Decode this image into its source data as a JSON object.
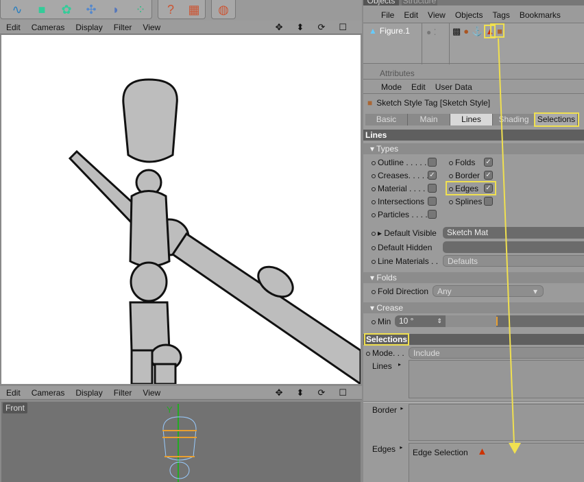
{
  "toolbar": {
    "icons": [
      "spline-pen-icon",
      "cube-icon",
      "array-icon",
      "deformer-icon",
      "bend-icon",
      "particles-icon",
      "help-cursor-icon",
      "help-table-icon",
      "render-globe-icon"
    ]
  },
  "viewport_top": {
    "menu": [
      "Edit",
      "Cameras",
      "Display",
      "Filter",
      "View"
    ],
    "nav_icons": [
      "move-icon",
      "zoom-icon",
      "rotate-icon",
      "maximize-icon"
    ]
  },
  "viewport_bottom": {
    "menu": [
      "Edit",
      "Cameras",
      "Display",
      "Filter",
      "View"
    ],
    "view_label": "Front",
    "axis_label": "Y"
  },
  "objects_panel": {
    "tabs": [
      "Objects",
      "Structure"
    ],
    "menu": [
      "File",
      "Edit",
      "View",
      "Objects",
      "Tags",
      "Bookmarks"
    ],
    "object_name": "Figure.1",
    "tags": [
      "checker-tag-icon",
      "spheres-tag-icon",
      "anchor-tag-icon",
      "edge-selection-tag-icon",
      "sketch-style-tag-icon"
    ]
  },
  "attributes": {
    "title": "Attributes",
    "menu": [
      "Mode",
      "Edit",
      "User Data"
    ],
    "tag_title": "Sketch Style Tag [Sketch Style]",
    "tabs": [
      "Basic",
      "Main",
      "Lines",
      "Shading",
      "Selections"
    ],
    "active_tab": "Lines"
  },
  "lines": {
    "header": "Lines",
    "types_header": "Types",
    "types_left": [
      {
        "label": "Outline . . . . .",
        "checked": false
      },
      {
        "label": "Creases. . . . .",
        "checked": true
      },
      {
        "label": "Material . . . .",
        "checked": false
      },
      {
        "label": "Intersections",
        "checked": false
      },
      {
        "label": "Particles . . . .",
        "checked": false
      }
    ],
    "types_right": [
      {
        "label": "Folds",
        "checked": true
      },
      {
        "label": "Border",
        "checked": true
      },
      {
        "label": "Edges",
        "checked": true
      },
      {
        "label": "Splines",
        "checked": false
      }
    ],
    "default_visible_label": "Default Visible",
    "default_visible_value": "Sketch Mat",
    "default_hidden_label": "Default Hidden",
    "default_hidden_value": "",
    "line_materials_label": "Line Materials . .",
    "line_materials_value": "Defaults"
  },
  "folds": {
    "header": "Folds",
    "direction_label": "Fold Direction",
    "direction_value": "Any"
  },
  "crease": {
    "header": "Crease",
    "min_label": "Min",
    "min_value": "10 °"
  },
  "selections": {
    "header": "Selections",
    "mode_label": "Mode. . .",
    "mode_value": "Include",
    "lines_label": "Lines",
    "border_label": "Border",
    "edges_label": "Edges",
    "edges_item": "Edge Selection"
  },
  "colors": {
    "highlight": "#f0e050",
    "panel": "#9b9b9b",
    "header": "#5f5f5f"
  }
}
